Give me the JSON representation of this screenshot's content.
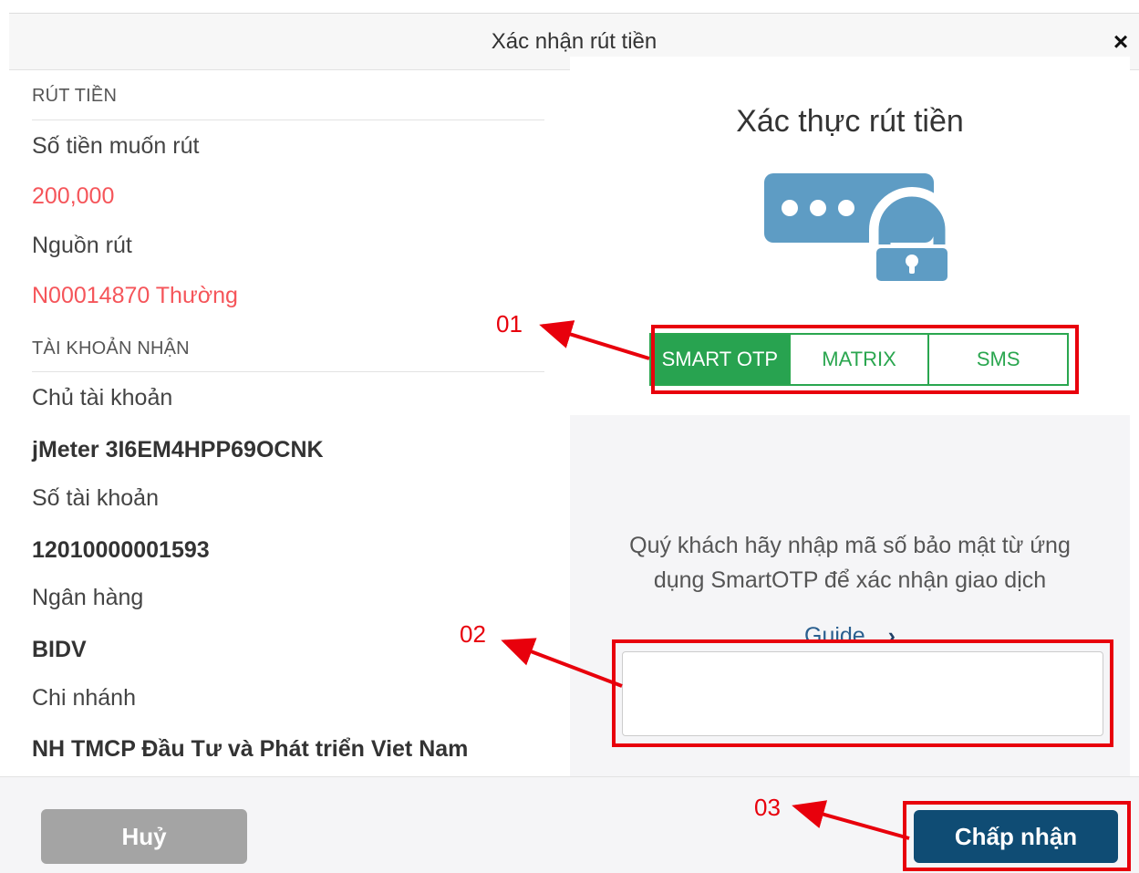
{
  "dialog": {
    "title": "Xác nhận rút tiền",
    "close_icon": "close-icon"
  },
  "withdraw": {
    "section_title": "RÚT TIỀN",
    "amount_label": "Số tiền muốn rút",
    "amount_value": "200,000",
    "source_label": "Nguồn rút",
    "source_value": "N00014870 Thường"
  },
  "receiver": {
    "section_title": "TÀI KHOẢN NHẬN",
    "holder_label": "Chủ tài khoản",
    "holder_value": "jMeter 3I6EM4HPP69OCNK",
    "account_label": "Số tài khoản",
    "account_value": "12010000001593",
    "bank_label": "Ngân hàng",
    "bank_value": "BIDV",
    "branch_label": "Chi nhánh",
    "branch_value": "NH TMCP Đầu Tư và Phát triển Viet Nam"
  },
  "auth": {
    "title": "Xác thực rút tiền",
    "icon": "password-lock-icon",
    "tabs": [
      "SMART OTP",
      "MATRIX",
      "SMS"
    ],
    "selected_tab": "SMART OTP",
    "instruction_line1": "Quý khách hãy nhập mã số bảo mật từ ứng",
    "instruction_line2": "dụng SmartOTP để xác nhận giao dịch",
    "guide_label": "Guide",
    "guide_arrow": "›",
    "otp_value": "",
    "otp_placeholder": ""
  },
  "footer": {
    "cancel_label": "Huỷ",
    "accept_label": "Chấp nhận"
  },
  "annotations": {
    "label_01": "01",
    "label_02": "02",
    "label_03": "03"
  },
  "colors": {
    "accent_red": "#f5555a",
    "annotation_red": "#e8000c",
    "tab_green": "#28a350",
    "accept_blue": "#0f4c74",
    "cancel_gray": "#a4a4a4",
    "icon_blue": "#5e9cc4"
  }
}
